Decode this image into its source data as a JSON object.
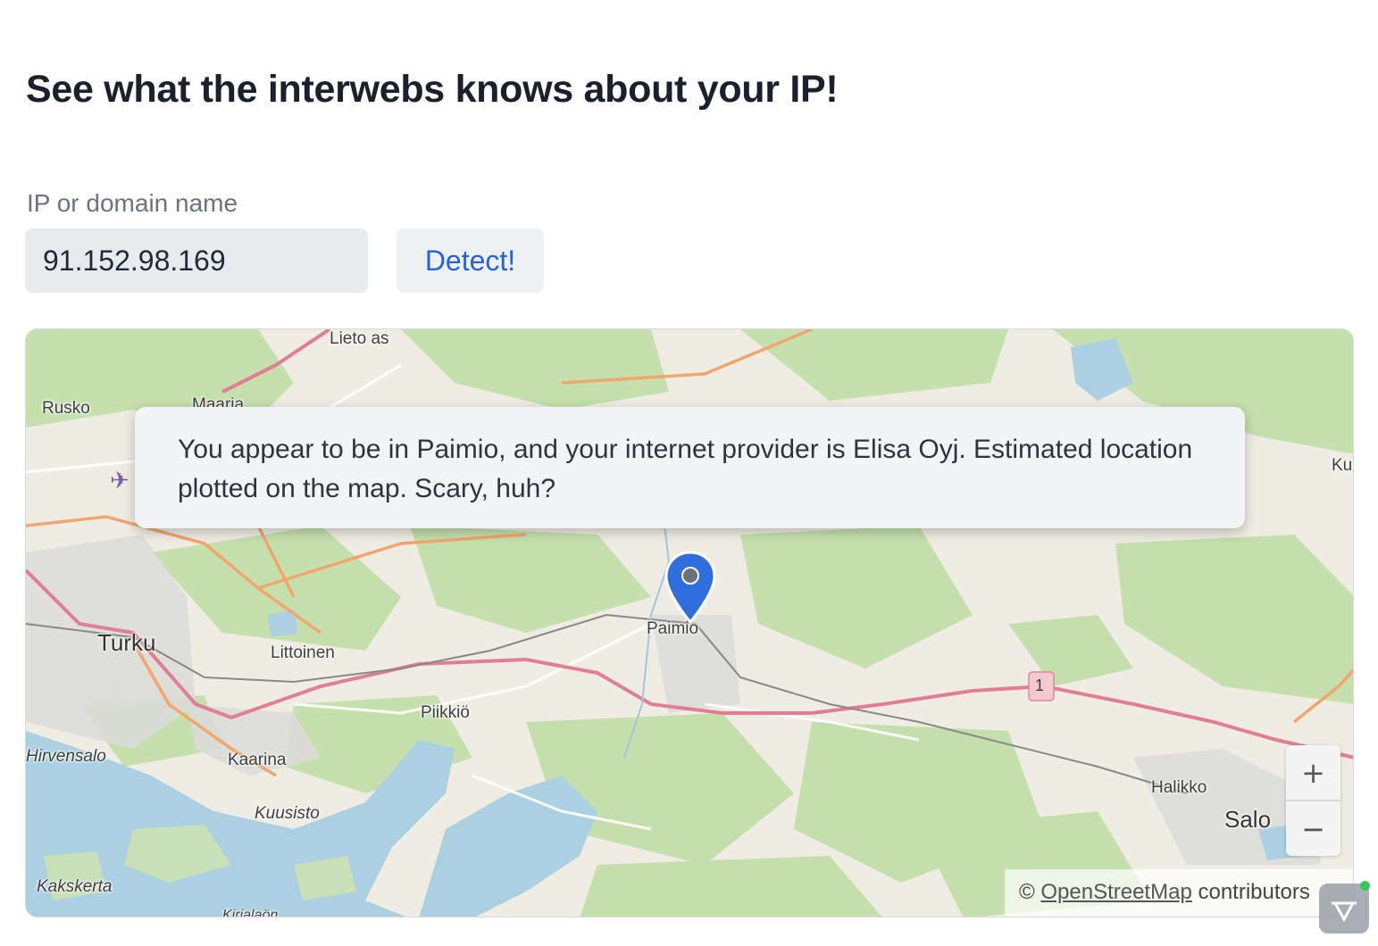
{
  "page": {
    "title": "See what the interwebs knows about your IP!"
  },
  "form": {
    "label": "IP or domain name",
    "input_value": "91.152.98.169",
    "button_label": "Detect!"
  },
  "map": {
    "info_text": "You appear to be in Paimio, and your internet provider is Elisa Oyj. Estimated location plotted on the map. Scary, huh?",
    "marker_location": "Paimio",
    "places": {
      "lieto": "Lieto as",
      "rusko": "Rusko",
      "maaria": "Maaria",
      "ku": "Ku",
      "turku": "Turku",
      "littoinen": "Littoinen",
      "paimio": "Paimio",
      "piikkio": "Piikkiö",
      "hirvensalo": "Hirvensalo",
      "kaarina": "Kaarina",
      "kuusisto": "Kuusisto",
      "kakskerta": "Kakskerta",
      "kirjala": "Kirjalaön",
      "halikko": "Halikko",
      "salo": "Salo",
      "road_number": "1"
    },
    "zoom_in_label": "+",
    "zoom_out_label": "−",
    "attribution_prefix": "© ",
    "attribution_link": "OpenStreetMap",
    "attribution_suffix": " contributors"
  },
  "colors": {
    "accent": "#2563d6",
    "marker": "#2f6fdd",
    "motorway": "#e07a8f",
    "primary_road": "#f0a870",
    "forest": "#b9d9a0",
    "water": "#a9cfe0"
  },
  "icons": {
    "marker": "map-pin-icon",
    "airport": "airplane-icon",
    "extension": "extension-icon"
  }
}
